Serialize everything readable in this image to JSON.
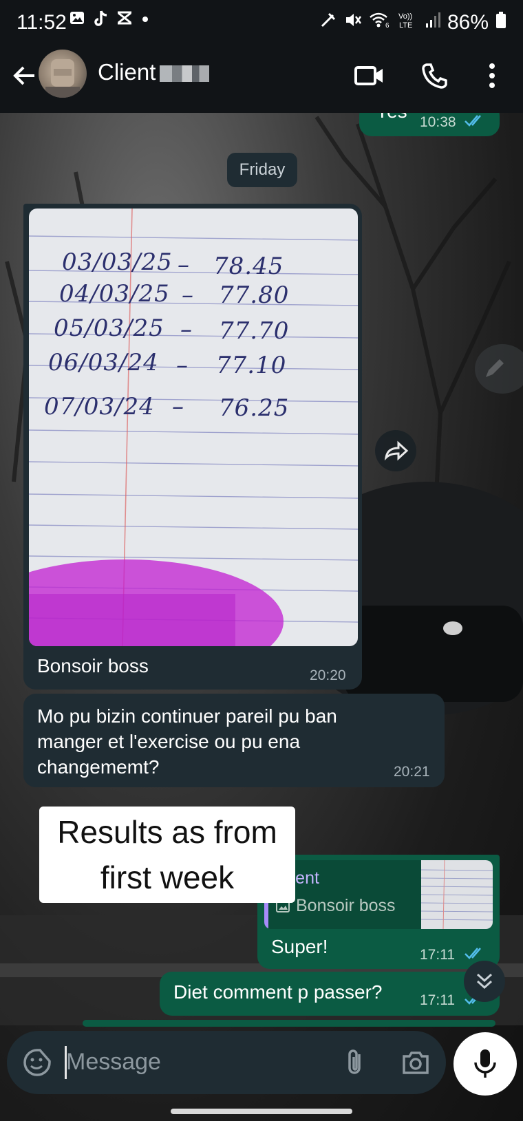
{
  "status_bar": {
    "time": "11:52",
    "battery": "86%",
    "icons_left": [
      "gallery-icon",
      "tiktok-icon",
      "capcut-icon",
      "dot-icon"
    ],
    "icons_right": [
      "data-saver-icon",
      "mute-icon",
      "wifi-6-icon",
      "volte-lte-icon",
      "signal-icon",
      "battery-icon"
    ]
  },
  "header": {
    "contact_name": "Client",
    "actions": [
      "video-call-icon",
      "voice-call-icon",
      "more-options-icon"
    ]
  },
  "messages": {
    "prev_out": {
      "text": "Yes",
      "time": "10:38"
    },
    "day_separator": "Friday",
    "image_message": {
      "handwritten_rows": [
        {
          "date": "03/03/25",
          "value": "78.45"
        },
        {
          "date": "04/03/25",
          "value": "77.80"
        },
        {
          "date": "05/03/25",
          "value": "77.70"
        },
        {
          "date": "06/03/24",
          "value": "77.10"
        },
        {
          "date": "07/03/24",
          "value": "76.25"
        }
      ],
      "caption": "Bonsoir boss",
      "time": "20:20"
    },
    "text_in": {
      "text": "Mo pu bizin continuer pareil  pu ban manger et l'exercise ou pu ena changememt?",
      "time": "20:21"
    },
    "reply_out": {
      "quoted_author": "Client",
      "quoted_text": "Bonsoir boss",
      "text": "Super!",
      "time": "17:11"
    },
    "last_out": {
      "text": "Diet comment p passer?",
      "time": "17:11"
    }
  },
  "overlay_caption": {
    "line1": "Results as from",
    "line2": "first week"
  },
  "composer": {
    "placeholder": "Message"
  },
  "colors": {
    "incoming_bubble": "#1f2c33",
    "outgoing_bubble": "#0b5b43",
    "read_ticks": "#53bdeb"
  }
}
